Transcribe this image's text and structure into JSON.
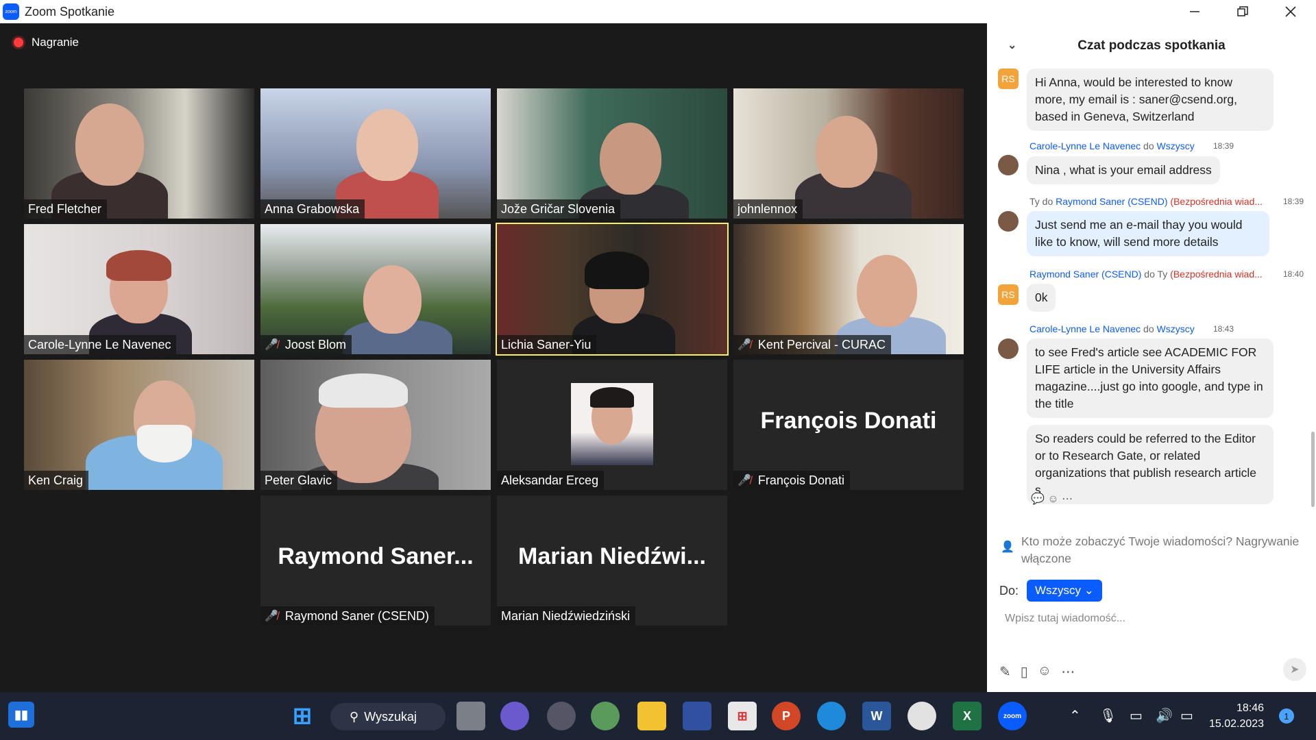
{
  "window": {
    "title": "Zoom Spotkanie",
    "logo_text": "zoom"
  },
  "recording": {
    "label": "Nagranie"
  },
  "participants": [
    {
      "name": "Fred Fletcher",
      "muted": false
    },
    {
      "name": "Anna Grabowska",
      "muted": false
    },
    {
      "name": "Jože Gričar Slovenia",
      "muted": false
    },
    {
      "name": "johnlennox",
      "muted": false
    },
    {
      "name": "Carole-Lynne Le Navenec",
      "muted": false
    },
    {
      "name": "Joost Blom",
      "muted": true
    },
    {
      "name": "Lichia Saner-Yiu",
      "muted": false,
      "active_speaker": true
    },
    {
      "name": "Kent Percival - CURAC",
      "muted": true
    },
    {
      "name": "Ken Craig",
      "muted": false
    },
    {
      "name": "Peter Glavic",
      "muted": false
    },
    {
      "name": "Aleksandar Erceg",
      "muted": false
    },
    {
      "name": "François Donati",
      "muted": true,
      "video_off_label": "François Donati"
    },
    {
      "name": "Raymond Saner (CSEND)",
      "muted": true,
      "video_off_label": "Raymond  Saner..."
    },
    {
      "name": "Marian Niedźwiedziński",
      "muted": false,
      "video_off_label": "Marian  Niedźwi..."
    }
  ],
  "chat": {
    "title": "Czat podczas spotkania",
    "messages": [
      {
        "avatar": "RS",
        "text": "Hi Anna, would be interested to know more, my email is :  saner@csend.org, based in Geneva, Switzerland"
      },
      {
        "sender": "Carole-Lynne Le Navenec",
        "to_word": "do",
        "recipient": "Wszyscy",
        "time": "18:39",
        "text": "Nina , what is your email address"
      },
      {
        "sender_prefix": "Ty do",
        "sender": "Raymond Saner (CSEND)",
        "direct": "(Bezpośrednia wiad...",
        "time": "18:39",
        "text": "Just send me an e-mail thay you would like to know, will send more details"
      },
      {
        "sender": "Raymond Saner (CSEND)",
        "to_word": "do Ty",
        "direct": "(Bezpośrednia wiad...",
        "time": "18:40",
        "avatar": "RS",
        "text": "0k"
      },
      {
        "sender": "Carole-Lynne Le Navenec",
        "to_word": "do",
        "recipient": "Wszyscy",
        "time": "18:43",
        "text": "to see Fred's article see ACADEMIC FOR LIFE article in the University Affairs magazine....just go into google, and type in the title"
      },
      {
        "text": "So readers could be referred to the Editor or to Research Gate, or related organizations that publish research article s"
      }
    ],
    "privacy_info": "Kto może zobaczyć Twoje wiadomości? Nagrywanie włączone",
    "to_label": "Do:",
    "to_value": "Wszyscy",
    "input_placeholder": "Wpisz tutaj wiadomość..."
  },
  "taskbar": {
    "search_label": "Wyszukaj",
    "time": "18:46",
    "date": "15.02.2023",
    "notifications": "1"
  }
}
